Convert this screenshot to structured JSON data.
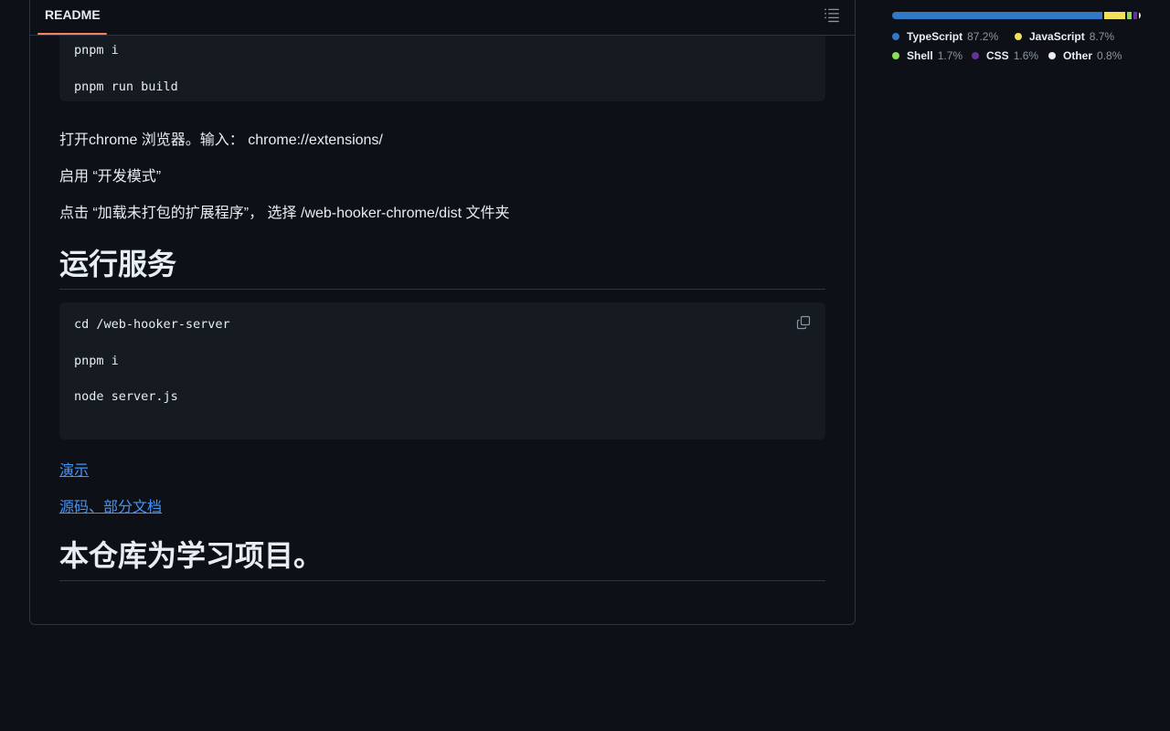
{
  "readme": {
    "tab_label": "README",
    "code_block_1": [
      "pnpm i",
      "",
      "pnpm run build"
    ],
    "para_1": "打开chrome 浏览器。输入： chrome://extensions/",
    "para_2": "启用 “开发模式”",
    "para_3": "点击 “加载未打包的扩展程序”， 选择 /web-hooker-chrome/dist 文件夹",
    "heading_1": "运行服务",
    "code_block_2": [
      "cd /web-hooker-server",
      "",
      "pnpm i",
      "",
      "node server.js"
    ],
    "link_1": "演示",
    "link_2": "源码、部分文档",
    "heading_2": "本仓库为学习项目。"
  },
  "languages": [
    {
      "name": "TypeScript",
      "percent": "87.2%",
      "value": 87.2,
      "color": "#3178c6"
    },
    {
      "name": "JavaScript",
      "percent": "8.7%",
      "value": 8.7,
      "color": "#f1e05a"
    },
    {
      "name": "Shell",
      "percent": "1.7%",
      "value": 1.7,
      "color": "#89e051"
    },
    {
      "name": "CSS",
      "percent": "1.6%",
      "value": 1.6,
      "color": "#663399"
    },
    {
      "name": "Other",
      "percent": "0.8%",
      "value": 0.8,
      "color": "#ededed"
    }
  ],
  "colors": {
    "background": "#0d1117",
    "border": "#30363d",
    "code_bg": "#161b22",
    "link": "#4493f8",
    "tab_accent": "#f78166"
  }
}
